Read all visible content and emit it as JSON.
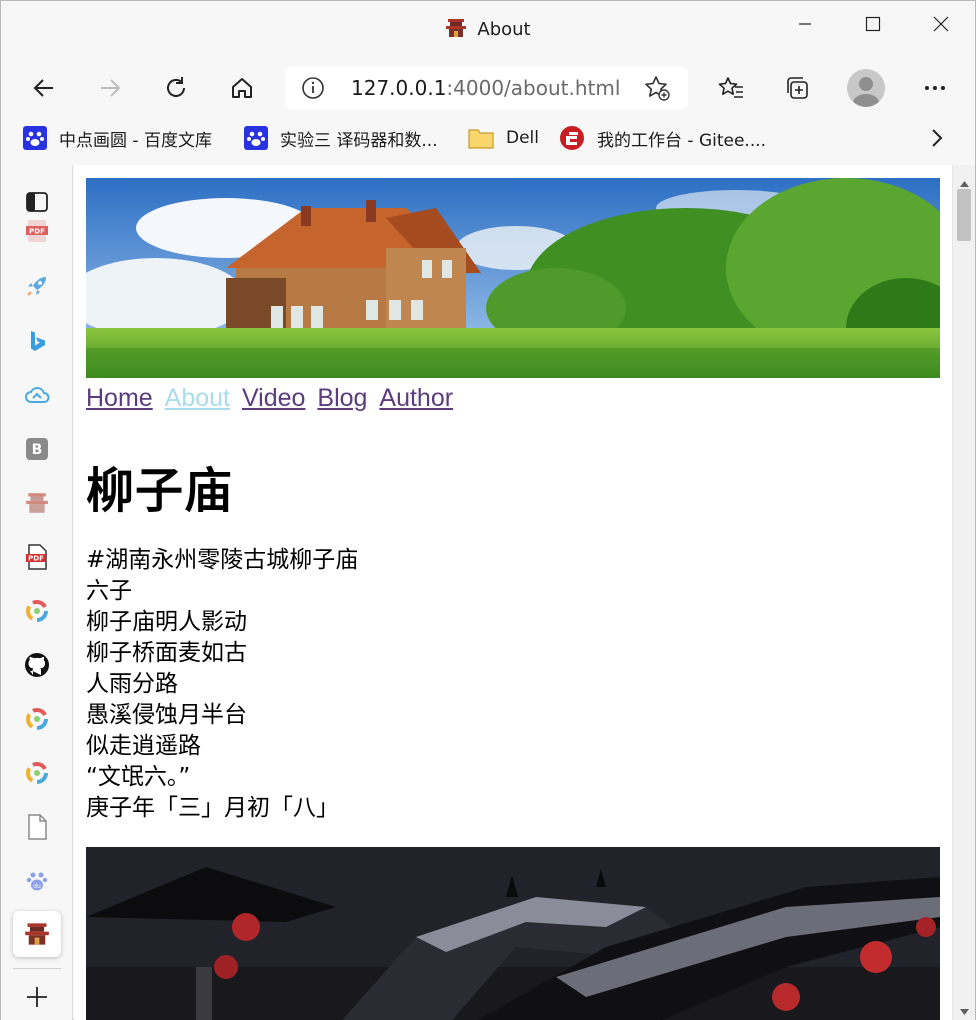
{
  "window": {
    "title": "About",
    "controls": [
      "minimize",
      "maximize",
      "close"
    ]
  },
  "toolbar": {
    "url_host": "127.0.0.1",
    "url_rest": ":4000/about.html",
    "icons": [
      "back-icon",
      "forward-icon",
      "refresh-icon",
      "home-icon",
      "info-icon",
      "add-favorite-icon",
      "favorites-icon",
      "collections-icon",
      "profile-avatar",
      "more-icon"
    ]
  },
  "favorites": [
    {
      "label": "中点画圆 - 百度文库",
      "icon": "baidu-paw-icon"
    },
    {
      "label": "实验三 译码器和数...",
      "icon": "baidu-paw-icon"
    },
    {
      "label": "Dell",
      "icon": "folder-icon"
    },
    {
      "label": "我的工作台 - Gitee....",
      "icon": "gitee-icon"
    }
  ],
  "sidebar": {
    "icons": [
      "tab-actions-icon",
      "pdf-icon",
      "rocket-icon",
      "bing-icon",
      "cloud-icon",
      "b-app-icon",
      "pagoda-icon",
      "pdf-icon",
      "colorful-ring-icon",
      "github-icon",
      "colorful-ring-icon",
      "colorful-ring-icon",
      "document-icon",
      "baidu-paw-icon",
      "pagoda-icon",
      "add-icon"
    ]
  },
  "page": {
    "nav": {
      "home": "Home",
      "about": "About",
      "video": "Video",
      "blog": "Blog",
      "author": "Author"
    },
    "heading": "柳子庙",
    "poem": [
      "#湖南永州零陵古城柳子庙",
      "六子",
      "柳子庙明人影动",
      "柳子桥面麦如古",
      "人雨分路",
      "愚溪侵蚀月半台",
      "似走逍遥路",
      "“文氓六。”",
      "庚子年「三」月初「八」"
    ]
  },
  "colors": {
    "link": "#5a3c7f",
    "link_current": "#a9dce8",
    "chrome": "#f7f7f7"
  }
}
